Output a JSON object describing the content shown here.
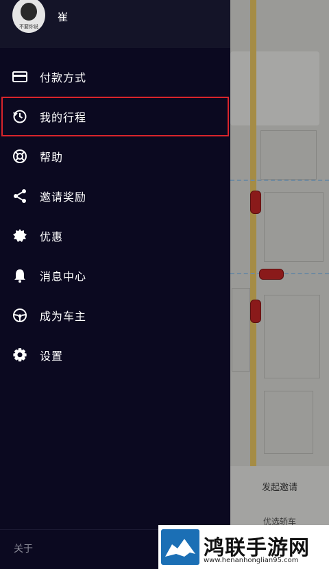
{
  "user": {
    "name": "崔",
    "avatar_caption": "不要你说"
  },
  "menu": [
    {
      "label": "付款方式",
      "icon": "credit-card-icon"
    },
    {
      "label": "我的行程",
      "icon": "trip-history-icon",
      "selected": true
    },
    {
      "label": "帮助",
      "icon": "lifebuoy-icon"
    },
    {
      "label": "邀请奖励",
      "icon": "share-icon"
    },
    {
      "label": "优惠",
      "icon": "badge-icon"
    },
    {
      "label": "消息中心",
      "icon": "bell-icon"
    },
    {
      "label": "成为车主",
      "icon": "steering-wheel-icon"
    },
    {
      "label": "设置",
      "icon": "gear-icon"
    }
  ],
  "footer": {
    "about": "关于"
  },
  "background": {
    "invite_label": "发起邀请",
    "option_label": "优选轿车"
  },
  "watermark": {
    "title": "鸿联手游网",
    "url": "www.henanhonglian95.com"
  },
  "colors": {
    "drawer_bg": "#0b0920",
    "selected_outline": "#d9242b",
    "text": "#ffffff"
  }
}
